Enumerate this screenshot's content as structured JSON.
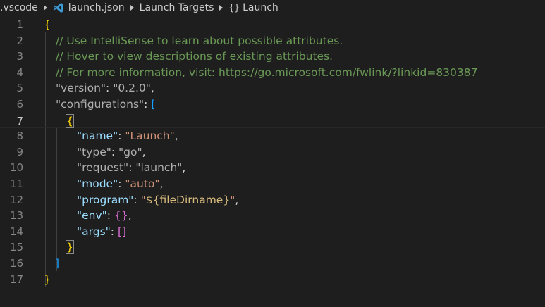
{
  "breadcrumb": {
    "folder": ".vscode",
    "file": "launch.json",
    "section": "Launch Targets",
    "symbol": "Launch",
    "symbol_icon": "{}"
  },
  "editor": {
    "line_numbers": [
      "1",
      "2",
      "3",
      "4",
      "5",
      "6",
      "7",
      "8",
      "9",
      "10",
      "11",
      "12",
      "13",
      "14",
      "15",
      "16",
      "17"
    ],
    "current_line": "7",
    "lines": {
      "l1_open": "{",
      "l2_comment": "// Use IntelliSense to learn about possible attributes.",
      "l3_comment": "// Hover to view descriptions of existing attributes.",
      "l4_comment": "// For more information, visit: ",
      "l4_link": "https://go.microsoft.com/fwlink/?linkid=830387",
      "l5_key": "\"version\"",
      "l5_colon": ": ",
      "l5_value": "\"0.2.0\"",
      "l5_comma": ",",
      "l6_key": "\"configurations\"",
      "l6_colon": ": ",
      "l6_bracket": "[",
      "l7_brace": "{",
      "l8_key": "\"name\"",
      "l8_colon": ": ",
      "l8_value": "\"Launch\"",
      "l8_comma": ",",
      "l9_key": "\"type\"",
      "l9_colon": ": ",
      "l9_value": "\"go\"",
      "l9_comma": ",",
      "l10_key": "\"request\"",
      "l10_colon": ": ",
      "l10_value": "\"launch\"",
      "l10_comma": ",",
      "l11_key": "\"mode\"",
      "l11_colon": ": ",
      "l11_value": "\"auto\"",
      "l11_comma": ",",
      "l12_key": "\"program\"",
      "l12_colon": ": ",
      "l12_q1": "\"",
      "l12_var": "${fileDirname}",
      "l12_q2": "\"",
      "l12_comma": ",",
      "l13_key": "\"env\"",
      "l13_colon": ": ",
      "l13_value": "{}",
      "l13_comma": ",",
      "l14_key": "\"args\"",
      "l14_colon": ": ",
      "l14_value": "[]",
      "l15_brace": "}",
      "l16_bracket": "]",
      "l17_close": "}"
    }
  },
  "colors": {
    "background": "#1e1e1e",
    "comment": "#6a9955",
    "key": "#9cdcfe",
    "string": "#ce9178",
    "bracket_gold": "#ffd700",
    "bracket_orchid": "#da70d6",
    "bracket_blue": "#179fff"
  }
}
